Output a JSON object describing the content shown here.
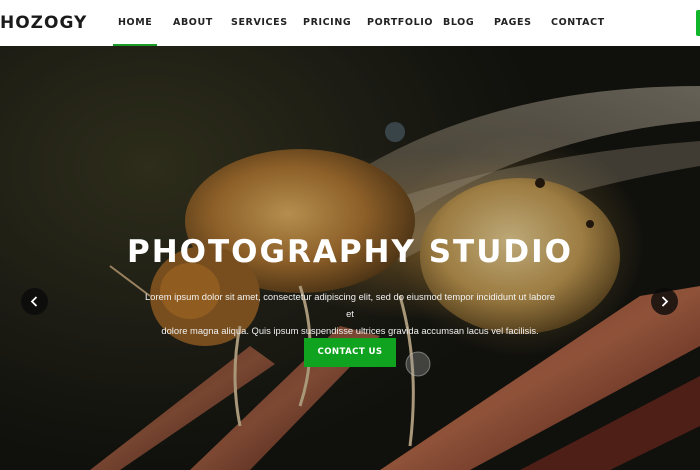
{
  "brand": {
    "logo_text": "HOZOGY"
  },
  "nav": {
    "items": [
      {
        "label": "HOME",
        "active": true
      },
      {
        "label": "ABOUT"
      },
      {
        "label": "SERVICES"
      },
      {
        "label": "PRICING"
      },
      {
        "label": "PORTFOLIO"
      },
      {
        "label": "BLOG"
      },
      {
        "label": "PAGES"
      },
      {
        "label": "CONTACT"
      }
    ]
  },
  "hero": {
    "title": "PHOTOGRAPHY STUDIO",
    "text_line1": "Lorem ipsum dolor sit amet, consectetur adipiscing elit, sed do eiusmod tempor incididunt ut labore et",
    "text_line2": "dolore magna aliqua. Quis ipsum suspendisse ultrices gravida accumsan lacus vel facilisis.",
    "cta_label": "CONTACT US",
    "prev_icon": "chevron-left-icon",
    "next_icon": "chevron-right-icon"
  },
  "colors": {
    "accent": "#10a31f",
    "nav_active_underline": "#1a9c28",
    "header_bg": "#ffffff",
    "nav_text": "#222222"
  }
}
